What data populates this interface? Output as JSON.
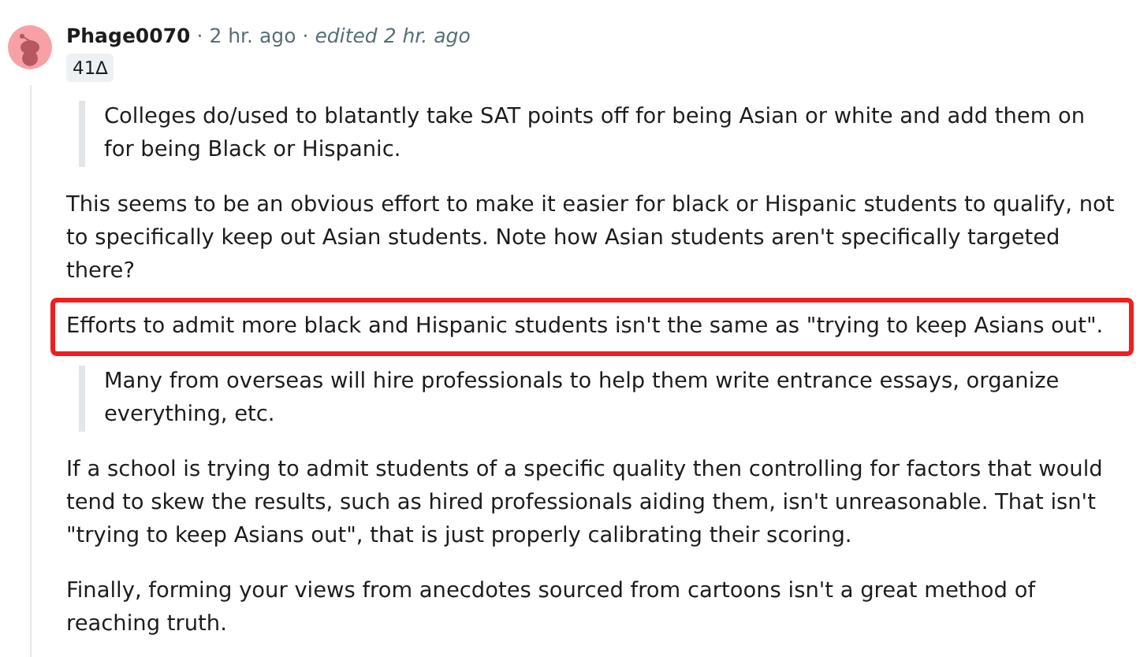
{
  "comment": {
    "author": "Phage0070",
    "separator": "·",
    "time": "2 hr. ago",
    "edited": "edited 2 hr. ago",
    "badge": "41∆",
    "blocks": [
      {
        "kind": "quote",
        "text": "Colleges do/used to blatantly take SAT points off for being Asian or white and add them on for being Black or Hispanic.",
        "highlighted": false
      },
      {
        "kind": "paragraph",
        "text": "This seems to be an obvious effort to make it easier for black or Hispanic students to qualify, not to specifically keep out Asian students. Note how Asian students aren't specifically targeted there?",
        "highlighted": false
      },
      {
        "kind": "paragraph",
        "text": "Efforts to admit more black and Hispanic students isn't the same as \"trying to keep Asians out\".",
        "highlighted": true
      },
      {
        "kind": "quote",
        "text": "Many from overseas will hire professionals to help them write entrance essays, organize everything, etc.",
        "highlighted": false
      },
      {
        "kind": "paragraph",
        "text": "If a school is trying to admit students of a specific quality then controlling for factors that would tend to skew the results, such as hired professionals aiding them, isn't unreasonable. That isn't \"trying to keep Asians out\", that is just properly calibrating their scoring.",
        "highlighted": false
      },
      {
        "kind": "paragraph",
        "text": "Finally, forming your views from anecdotes sourced from cartoons isn't a great method of reaching truth.",
        "highlighted": false
      }
    ]
  }
}
